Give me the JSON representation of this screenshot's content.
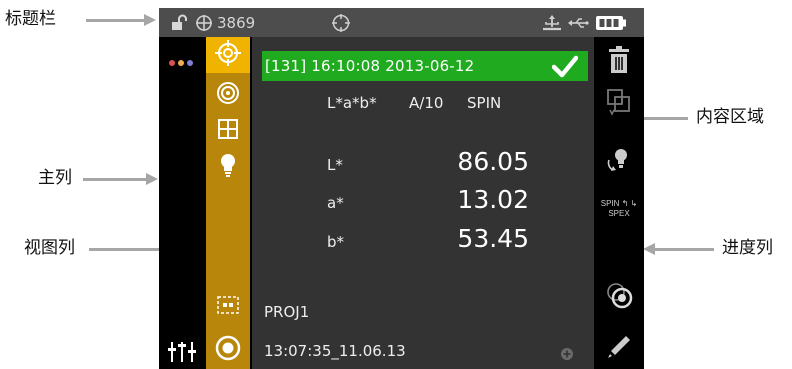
{
  "callouts": {
    "title_bar": "标题栏",
    "content_area": "内容区域",
    "main_column": "主列",
    "view_column": "视图列",
    "progress_column": "进度列"
  },
  "title_bar": {
    "counter": "3869"
  },
  "measurement": {
    "header": "[131] 16:10:08 2013-06-12",
    "color_space": "L*a*b*",
    "illuminant_observer": "A/10",
    "mode": "SPIN",
    "rows": [
      {
        "label": "L*",
        "value": "86.05"
      },
      {
        "label": "a*",
        "value": "13.02"
      },
      {
        "label": "b*",
        "value": "53.45"
      }
    ]
  },
  "footer": {
    "project": "PROJ1",
    "timestamp": "13:07:35_11.06.13"
  },
  "progress_column": {
    "spin_spex_label": "SPIN ↰ ↳ SPEX"
  },
  "colors": {
    "view_column_bg": "#b8860b",
    "selected_item_bg": "#f0b400",
    "status_green": "#1faa1f",
    "content_bg": "#333333",
    "titlebar_bg": "#4d4d4d"
  },
  "icons": {
    "title_bar": [
      "unlock-icon",
      "crosshair-icon",
      "target-icon",
      "usb-icon",
      "usb-icon",
      "battery-icon"
    ],
    "main_column": [
      "dots-menu-icon",
      "sliders-icon"
    ],
    "view_column": [
      "crosshair-target-icon",
      "concentric-circles-icon",
      "grid-icon",
      "bulb-icon",
      "dashed-frame-icon",
      "measure-ring-icon"
    ],
    "progress_column": [
      "trash-icon",
      "compare-icon",
      "bulb-rotate-icon",
      "spin-spex-icon",
      "measure-aperture-icon",
      "pencil-icon"
    ]
  }
}
